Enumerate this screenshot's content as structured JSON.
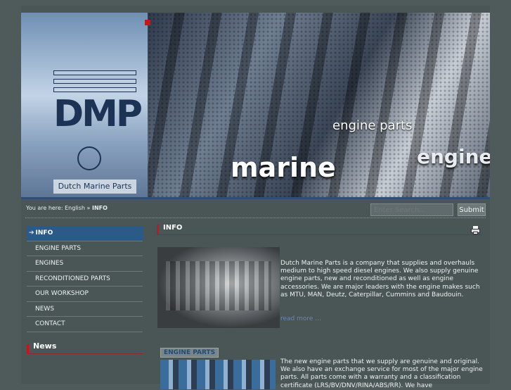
{
  "header": {
    "logo_letters": "DMP",
    "tagline": "Dutch Marine Parts",
    "banner_words": {
      "engine_parts": "engine parts",
      "marine": "marine",
      "engines": "engines"
    }
  },
  "breadcrumb": {
    "prefix": "You are here:",
    "home": "English",
    "separator": "»",
    "current": "INFO"
  },
  "search": {
    "placeholder": "Enter Search...",
    "submit_label": "Submit"
  },
  "sidebar": {
    "items": [
      {
        "label": "INFO",
        "active": true
      },
      {
        "label": "ENGINE PARTS"
      },
      {
        "label": "ENGINES"
      },
      {
        "label": "RECONDITIONED PARTS"
      },
      {
        "label": "OUR WORKSHOP"
      },
      {
        "label": "NEWS"
      },
      {
        "label": "CONTACT"
      }
    ],
    "news_heading": "News"
  },
  "main": {
    "title": "INFO",
    "intro": "Dutch Marine Parts is a company that supplies and overhauls medium to high speed diesel engines. We also supply genuine engine parts, new and reconditioned as well as engine accessories. We are major leaders with the engine makes such as MTU, MAN, Deutz, Caterpillar, Cummins and Baudouin.",
    "read_more": "read more ...",
    "section_badge": "ENGINE PARTS",
    "parts_text": "The new engine parts that we supply are genuine and original. We also have an exchange service for most of the major engine parts. All parts come with a warranty and a classification certificate (LRS/BV/DNV/RINA/ABS/RR). We have"
  },
  "colors": {
    "accent_red": "#c4161c",
    "menu_active": "#2c5a86",
    "background": "#4a5555",
    "link": "#6b86a8"
  }
}
